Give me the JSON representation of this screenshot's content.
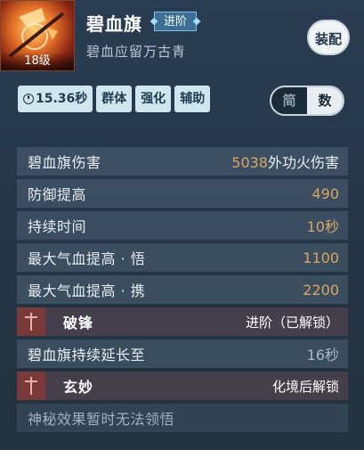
{
  "header": {
    "skill_name": "碧血旗",
    "advance_label": "进阶",
    "subtitle": "碧血应留万古青",
    "level": "18级",
    "equip_label": "装配"
  },
  "tags": [
    {
      "label": "15.36秒",
      "icon": "clock-icon"
    },
    {
      "label": "群体"
    },
    {
      "label": "强化"
    },
    {
      "label": "辅助"
    }
  ],
  "toggle": {
    "option_a": "简",
    "option_b": "数",
    "selected": "数"
  },
  "stats": [
    {
      "label": "碧血旗伤害",
      "value": "5038",
      "unit": "外功火伤害"
    },
    {
      "label": "防御提高",
      "value": "490",
      "unit": ""
    },
    {
      "label": "持续时间",
      "value": "10",
      "unit": "秒"
    },
    {
      "label": "最大气血提高 · 悟",
      "value": "1100",
      "unit": ""
    },
    {
      "label": "最大气血提高 · 携",
      "value": "2200",
      "unit": ""
    }
  ],
  "sections": [
    {
      "title": "破锋",
      "status": "进阶（已解锁）",
      "icon": "sword-icon",
      "detail_label": "碧血旗持续延长至",
      "detail_value": "16秒"
    },
    {
      "title": "玄妙",
      "status": "化境后解锁",
      "icon": "sword-icon",
      "detail_label": "神秘效果暂时无法领悟",
      "detail_value": ""
    }
  ],
  "colors": {
    "accent_value": "#d7a666",
    "tag_bg": "#cfe6ef",
    "section_bg": "#604850"
  }
}
